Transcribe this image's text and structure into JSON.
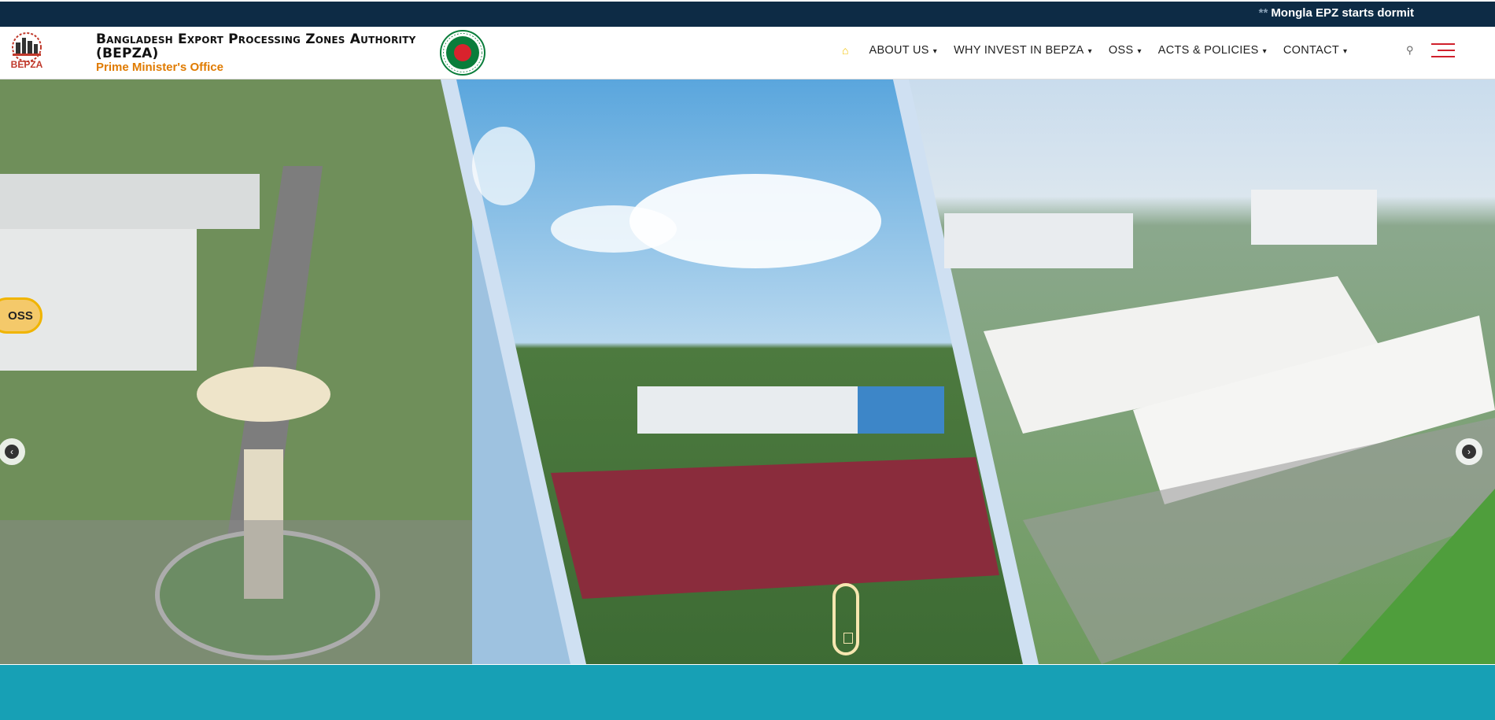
{
  "topbar": {
    "ticker_text": "Mongla EPZ starts dormit",
    "ticker_mark": "**"
  },
  "header": {
    "org_title": "Bangladesh Export Processing Zones Authority (BEPZA)",
    "org_subtitle": "Prime Minister's Office",
    "logo_text": "BEPZA"
  },
  "nav": {
    "home_icon": "home-icon",
    "items": [
      {
        "label": "ABOUT US"
      },
      {
        "label": "WHY INVEST IN BEPZA"
      },
      {
        "label": "OSS"
      },
      {
        "label": "ACTS & POLICIES"
      },
      {
        "label": "CONTACT"
      }
    ],
    "caret": "▾",
    "search_icon": "search-icon",
    "menu_icon": "hamburger-menu-icon"
  },
  "hero": {
    "oss_tab_label": "OSS",
    "prev_icon": "chevron-left-icon",
    "next_icon": "chevron-right-icon",
    "prev_glyph": "‹",
    "next_glyph": "›"
  },
  "colors": {
    "topbar": "#0d2b45",
    "accent_yellow": "#f0b400",
    "subtitle_orange": "#e07b00",
    "menu_red": "#d0202c",
    "teal": "#17a0b5"
  }
}
